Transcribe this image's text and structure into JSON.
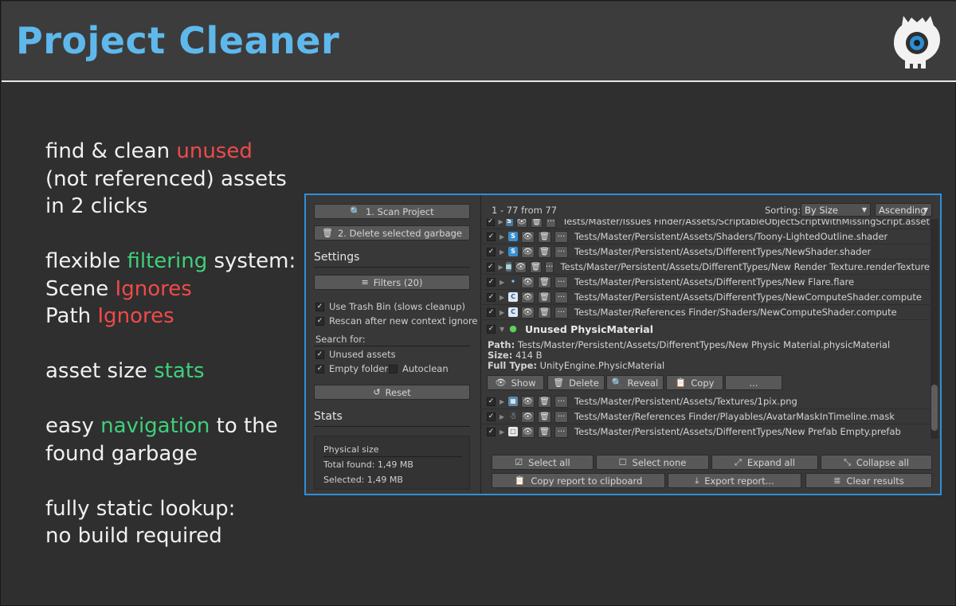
{
  "header": {
    "title": "Project Cleaner",
    "logo_icon": "robot-eye-icon",
    "accent": "#5fb8ec"
  },
  "features": [
    [
      "find & clean ",
      "unused"
    ],
    [
      "(not referenced) assets",
      ""
    ],
    [
      "in 2 clicks",
      ""
    ],
    [
      "flexible ",
      "filtering",
      " system:"
    ],
    [
      "Scene ",
      "Ignores"
    ],
    [
      "Path ",
      "Ignores"
    ],
    [
      "asset size ",
      "stats"
    ],
    [
      "easy ",
      "navigation",
      " to the"
    ],
    [
      "found garbage",
      ""
    ],
    [
      "fully static lookup:",
      ""
    ],
    [
      "no build required",
      ""
    ]
  ],
  "sidebar": {
    "scan_button": "1. Scan Project",
    "delete_button": "2. Delete selected garbage",
    "settings_title": "Settings",
    "filters_button": "Filters (20)",
    "use_trash_bin": "Use Trash Bin (slows cleanup)",
    "rescan": "Rescan after new context ignore",
    "search_for": "Search for:",
    "unused_assets": "Unused assets",
    "empty_folders": "Empty folders",
    "autoclean": "Autoclean",
    "reset_button": "Reset",
    "stats_title": "Stats",
    "physical_size": "Physical size",
    "total_found": "Total found: 1,49 MB",
    "selected": "Selected: 1,49 MB"
  },
  "results": {
    "count": "1 - 77 from 77",
    "sorting_label": "Sorting:",
    "sort_by": "By Size",
    "sort_order": "Ascending",
    "rows_top": [
      {
        "icon": "script-icon",
        "path": "Tests/Master/Issues Finder/Assets/ScriptableObjectScriptWithMissingScript.asset"
      },
      {
        "icon": "shader-icon",
        "path": "Tests/Master/Persistent/Assets/Shaders/Toony-LightedOutline.shader"
      },
      {
        "icon": "shader-icon",
        "path": "Tests/Master/Persistent/Assets/DifferentTypes/NewShader.shader"
      },
      {
        "icon": "render-texture-icon",
        "path": "Tests/Master/Persistent/Assets/DifferentTypes/New Render Texture.renderTexture"
      },
      {
        "icon": "flare-icon",
        "path": "Tests/Master/Persistent/Assets/DifferentTypes/New Flare.flare"
      },
      {
        "icon": "compute-shader-icon",
        "path": "Tests/Master/Persistent/Assets/DifferentTypes/NewComputeShader.compute"
      },
      {
        "icon": "compute-shader-icon",
        "path": "Tests/Master/References Finder/Shaders/NewComputeShader.compute"
      }
    ],
    "expanded": {
      "title": "Unused PhysicMaterial",
      "path_label": "Path:",
      "path_value": " Tests/Master/Persistent/Assets/DifferentTypes/New Physic Material.physicMaterial",
      "size_label": "Size:",
      "size_value": " 414 B",
      "type_label": "Full Type:",
      "type_value": " UnityEngine.PhysicMaterial",
      "show": "Show",
      "delete": "Delete",
      "reveal": "Reveal",
      "copy": "Copy",
      "more": "..."
    },
    "rows_bottom": [
      {
        "icon": "texture-icon",
        "path": "Tests/Master/Persistent/Assets/Textures/1pix.png"
      },
      {
        "icon": "avatar-mask-icon",
        "path": "Tests/Master/References Finder/Playables/AvatarMaskInTimeline.mask"
      },
      {
        "icon": "prefab-icon",
        "path": "Tests/Master/Persistent/Assets/DifferentTypes/New Prefab Empty.prefab"
      }
    ],
    "buttons": {
      "select_all": "Select all",
      "select_none": "Select none",
      "expand_all": "Expand all",
      "collapse_all": "Collapse all",
      "copy_report": "Copy report to clipboard",
      "export_report": "Export report...",
      "clear_results": "Clear results"
    }
  }
}
